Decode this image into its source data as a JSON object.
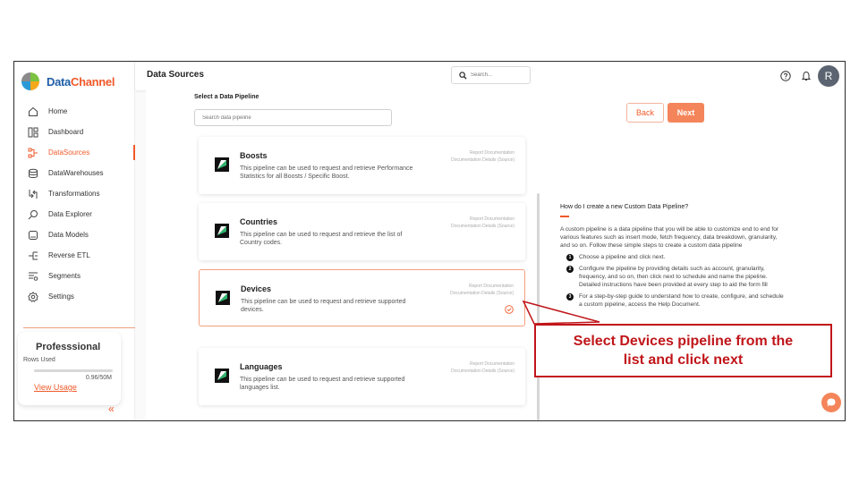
{
  "brand": {
    "name_part1": "Data",
    "name_part2": "Channel"
  },
  "sidebar": {
    "items": [
      {
        "label": "Home",
        "icon": "home-icon"
      },
      {
        "label": "Dashboard",
        "icon": "dashboard-icon"
      },
      {
        "label": "DataSources",
        "icon": "datasources-icon",
        "active": true
      },
      {
        "label": "DataWarehouses",
        "icon": "database-icon"
      },
      {
        "label": "Transformations",
        "icon": "transform-icon"
      },
      {
        "label": "Data Explorer",
        "icon": "explorer-icon"
      },
      {
        "label": "Data Models",
        "icon": "models-icon"
      },
      {
        "label": "Reverse ETL",
        "icon": "reverse-etl-icon"
      },
      {
        "label": "Segments",
        "icon": "segments-icon"
      },
      {
        "label": "Settings",
        "icon": "gear-icon"
      }
    ],
    "plan": {
      "title": "Professsional",
      "rows_label": "Rows Used",
      "rows_count": "0.96/50M",
      "rows_used_fraction": 0.02,
      "link": "View Usage"
    },
    "collapse": "«"
  },
  "header": {
    "title": "Data Sources",
    "search_placeholder": "Search...",
    "avatar_initial": "R"
  },
  "main": {
    "select_label": "Select a Data Pipeline",
    "search_placeholder": "Search data pipeline",
    "back_label": "Back",
    "next_label": "Next",
    "pipelines": [
      {
        "title": "Boosts",
        "desc": "This pipeline can be used to request and retrieve Performance Statistics for all Boosts / Specific Boost.",
        "link1": "Report Documentation",
        "link2": "Documentation Details (Source)",
        "selected": false
      },
      {
        "title": "Countries",
        "desc": "This pipeline can be used to request and retrieve the list of Country codes.",
        "link1": "Report Documentation",
        "link2": "Documentation Details (Source)",
        "selected": false
      },
      {
        "title": "Devices",
        "desc": "This pipeline can be used to request and retrieve supported devices.",
        "link1": "Report Documentation",
        "link2": "Documentation Details (Source)",
        "selected": true
      },
      {
        "title": "Languages",
        "desc": "This pipeline can be used to request and retrieve supported languages list.",
        "link1": "Report Documentation",
        "link2": "Documentation Details (Source)",
        "selected": false
      }
    ]
  },
  "help": {
    "question": "How do I create a new Custom Data Pipeline?",
    "intro": "A custom pipeline is a data pipeline that you will be able to customize end to end for various features such as insert mode, fetch frequency, data breakdown, granularity, and so on. Follow these simple steps to create a custom data pipeline",
    "steps": [
      {
        "num": "1",
        "text": "Choose a pipeline and click next."
      },
      {
        "num": "2",
        "text": "Configure the pipeline by providing details such as account, granularity, frequency, and so on, then click next to schedule and name the pipeline. Detailed instructions have been provided at every step to aid the form fill"
      },
      {
        "num": "3",
        "text": "For a step-by-step guide to understand how to create, configure, and schedule a custom pipeline, access the Help Document."
      }
    ]
  },
  "annotation": {
    "text_line1": "Select Devices pipeline from the",
    "text_line2": "list and click next",
    "color": "#c0151a"
  },
  "colors": {
    "accent": "#f0592a",
    "next_button": "#f4855a"
  }
}
